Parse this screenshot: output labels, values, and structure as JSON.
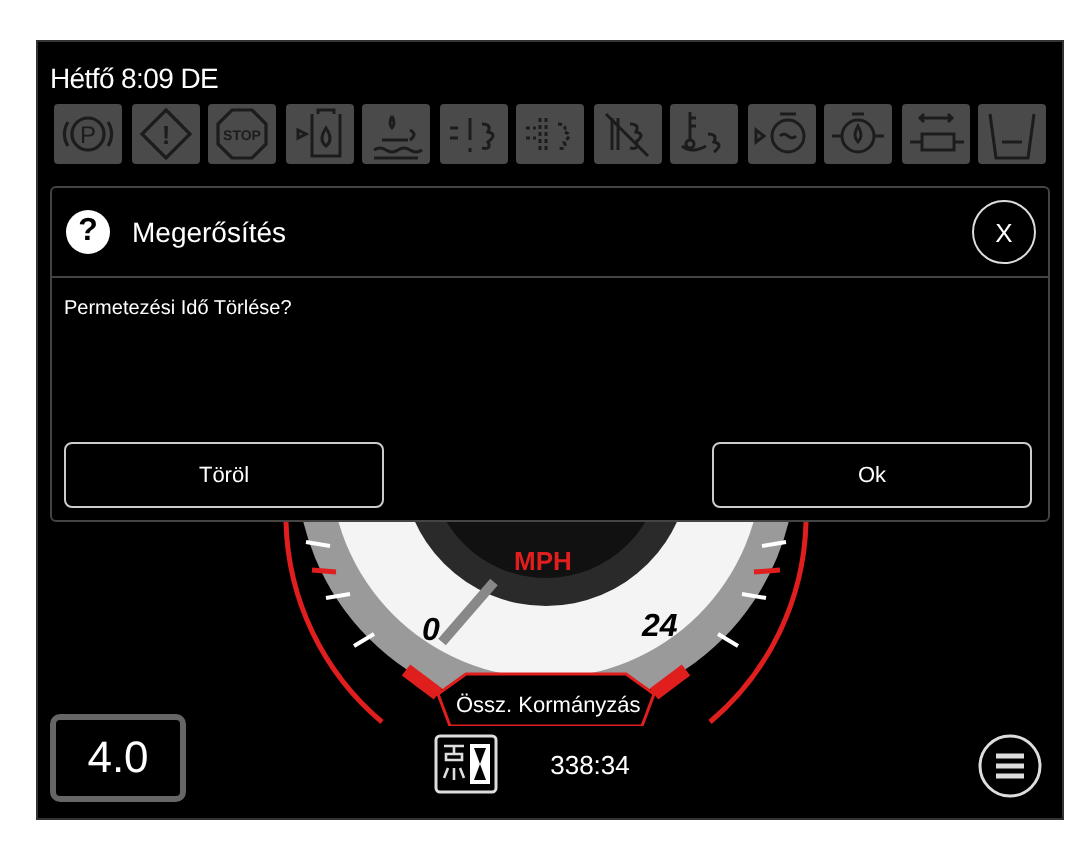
{
  "header": {
    "datetime": "Hétfő 8:09 DE"
  },
  "status_icons": [
    {
      "kind": "parking",
      "label": "P"
    },
    {
      "kind": "warning",
      "label": "!"
    },
    {
      "kind": "stop",
      "label": "STOP"
    },
    {
      "kind": "tank"
    },
    {
      "kind": "coolant"
    },
    {
      "kind": "exhaust_alert"
    },
    {
      "kind": "exhaust_filter"
    },
    {
      "kind": "exhaust_off"
    },
    {
      "kind": "exhaust_temp"
    },
    {
      "kind": "engine"
    },
    {
      "kind": "oil"
    },
    {
      "kind": "cylinder"
    },
    {
      "kind": "bucket"
    }
  ],
  "dialog": {
    "icon": "?",
    "title": "Megerősítés",
    "close": "X",
    "message": "Permetezési Idő Törlése?",
    "buttons": [
      "Töröl",
      "Ok"
    ]
  },
  "gauge": {
    "unit": "MPH",
    "min": "0",
    "max": "24",
    "label": "Össz. Kormányzás"
  },
  "rate_display": "4.0",
  "timer": {
    "value": "338:34"
  }
}
